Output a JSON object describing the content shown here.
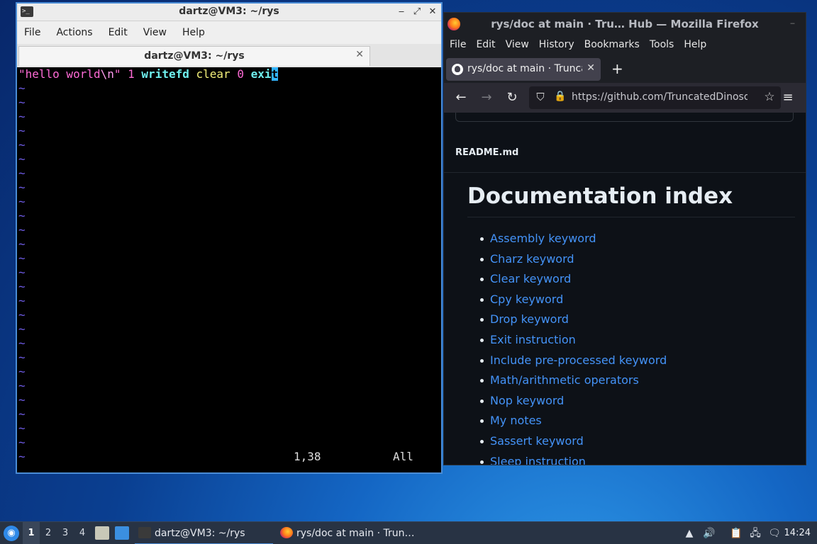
{
  "terminal": {
    "title": "dartz@VM3: ~/rys",
    "app_icon_glyph": ">_",
    "menu": [
      "File",
      "Actions",
      "Edit",
      "View",
      "Help"
    ],
    "tab_label": "dartz@VM3: ~/rys",
    "vim": {
      "line1": {
        "str": "\"hello world",
        "esc": "\\n",
        "str_end": "\"",
        "num1": "1",
        "kw1": "writefd",
        "kw2": "clear",
        "num2": "0",
        "kw3_pre": "exi",
        "cursor_char": "t"
      },
      "tilde_char": "~",
      "tilde_count": 27,
      "ruler_pos": "1,38",
      "ruler_view": "All"
    }
  },
  "firefox": {
    "title": "rys/doc at main · Tru… Hub — Mozilla Firefox",
    "menu": [
      "File",
      "Edit",
      "View",
      "History",
      "Bookmarks",
      "Tools",
      "Help"
    ],
    "tab_label": "rys/doc at main · TruncatedDinosour",
    "new_tab_glyph": "+",
    "url": "https://github.com/TruncatedDinosour/rys",
    "readme_filename": "README.md",
    "heading": "Documentation index",
    "links": [
      "Assembly keyword",
      "Charz keyword",
      "Clear keyword",
      "Cpy keyword",
      "Drop keyword",
      "Exit instruction",
      "Include pre-processed keyword",
      "Math/arithmetic operators",
      "Nop keyword",
      "My notes",
      "Sassert keyword",
      "Sleep instruction"
    ]
  },
  "taskbar": {
    "workspaces": [
      "1",
      "2",
      "3",
      "4"
    ],
    "active_workspace": "1",
    "tasks": [
      {
        "label": "dartz@VM3: ~/rys",
        "icon": "terminal-icon"
      },
      {
        "label": "rys/doc at main · Trun…",
        "icon": "firefox-icon"
      }
    ],
    "clock": "14:24"
  },
  "colors": {
    "terminal_border": "#4a8cd6",
    "link": "#4493f8",
    "vim_tilde": "#6f5ce8",
    "vim_keyword": "#6ff0ef",
    "vim_string": "#ff6bd6"
  }
}
